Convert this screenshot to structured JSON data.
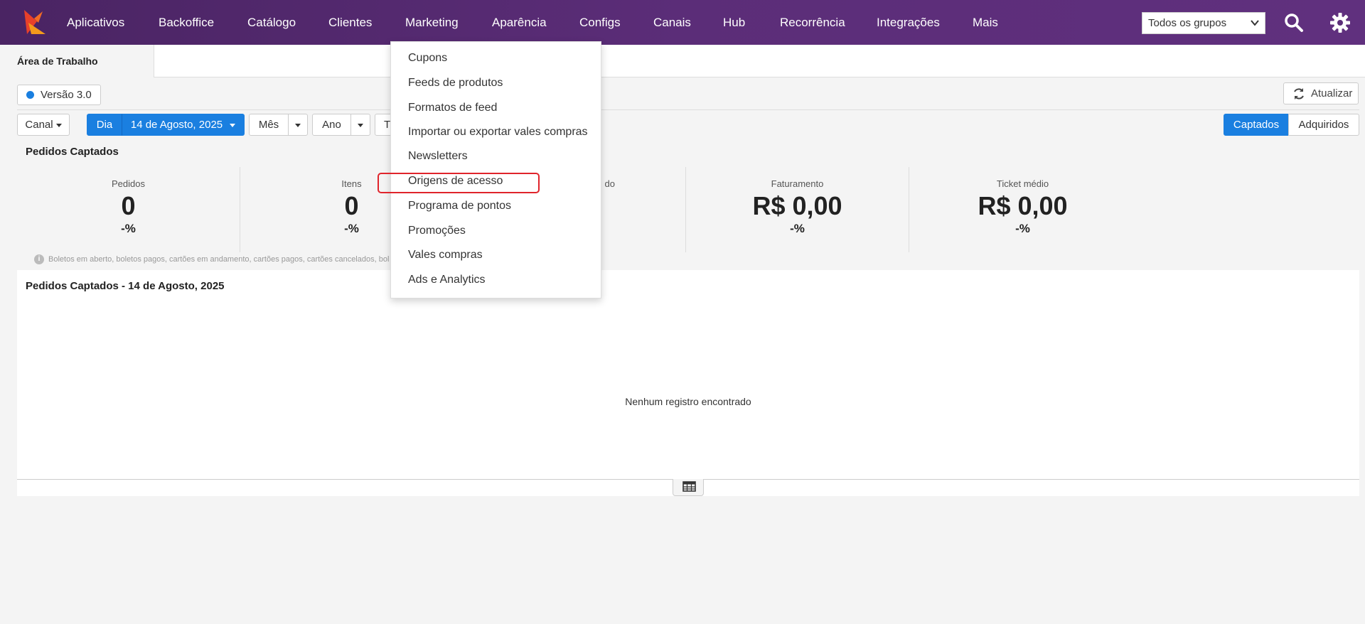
{
  "nav": {
    "items": [
      "Aplicativos",
      "Backoffice",
      "Catálogo",
      "Clientes",
      "Marketing",
      "Aparência",
      "Configs",
      "Canais",
      "Hub",
      "Recorrência",
      "Integrações",
      "Mais"
    ],
    "group_select": "Todos os grupos"
  },
  "tabs": {
    "active": "Área de Trabalho"
  },
  "toolbar": {
    "version": "Versão 3.0",
    "refresh": "Atualizar",
    "canal": "Canal",
    "dia": "Dia",
    "date": "14 de Agosto, 2025",
    "mes": "Mês",
    "ano": "Ano",
    "partial": "T",
    "captados": "Captados",
    "adquiridos": "Adquiridos"
  },
  "summary": {
    "title": "Pedidos Captados",
    "stats": [
      {
        "label": "Pedidos",
        "value": "0",
        "pct": "-%"
      },
      {
        "label": "Itens",
        "value": "0",
        "pct": "-%"
      },
      {
        "label": "do",
        "value": "",
        "pct": ""
      },
      {
        "label": "Faturamento",
        "value": "R$ 0,00",
        "pct": "-%"
      },
      {
        "label": "Ticket médio",
        "value": "R$ 0,00",
        "pct": "-%"
      }
    ],
    "note": "Boletos em aberto, boletos pagos, cartões em andamento, cartões pagos, cartões cancelados, bol"
  },
  "panel": {
    "title": "Pedidos Captados - 14 de Agosto, 2025",
    "empty": "Nenhum registro encontrado"
  },
  "dropdown": {
    "items": [
      "Cupons",
      "Feeds de produtos",
      "Formatos de feed",
      "Importar ou exportar vales compras",
      "Newsletters",
      "Origens de acesso",
      "Programa de pontos",
      "Promoções",
      "Vales compras",
      "Ads e Analytics"
    ],
    "highlighted": "Origens de acesso"
  },
  "colors": {
    "nav_bg": "#5b2d78",
    "accent": "#1a7fe0",
    "highlight": "#e0242b"
  }
}
